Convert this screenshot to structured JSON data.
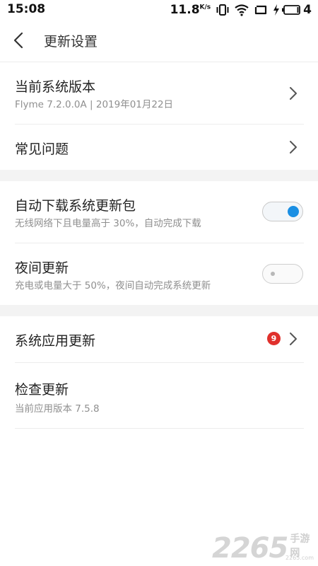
{
  "status_bar": {
    "time": "15:08",
    "net_speed": "11.8",
    "net_unit": "K/s",
    "battery_level": "4"
  },
  "header": {
    "title": "更新设置"
  },
  "rows": {
    "current_version": {
      "title": "当前系统版本",
      "subtitle": "Flyme 7.2.0.0A | 2019年01月22日"
    },
    "faq": {
      "title": "常见问题"
    },
    "auto_download": {
      "title": "自动下载系统更新包",
      "subtitle": "无线网络下且电量高于 30%，自动完成下载",
      "enabled": true
    },
    "night_update": {
      "title": "夜间更新",
      "subtitle": "充电或电量大于 50%，夜间自动完成系统更新",
      "enabled": false
    },
    "system_app_update": {
      "title": "系统应用更新",
      "badge": "9"
    },
    "check_update": {
      "title": "检查更新",
      "subtitle": "当前应用版本 7.5.8"
    }
  },
  "watermark": {
    "number": "2265",
    "text": "手游网",
    "url": "2265.com"
  },
  "colors": {
    "accent": "#1a8fe3",
    "badge": "#e0302c",
    "section_gap": "#f3f3f3"
  }
}
